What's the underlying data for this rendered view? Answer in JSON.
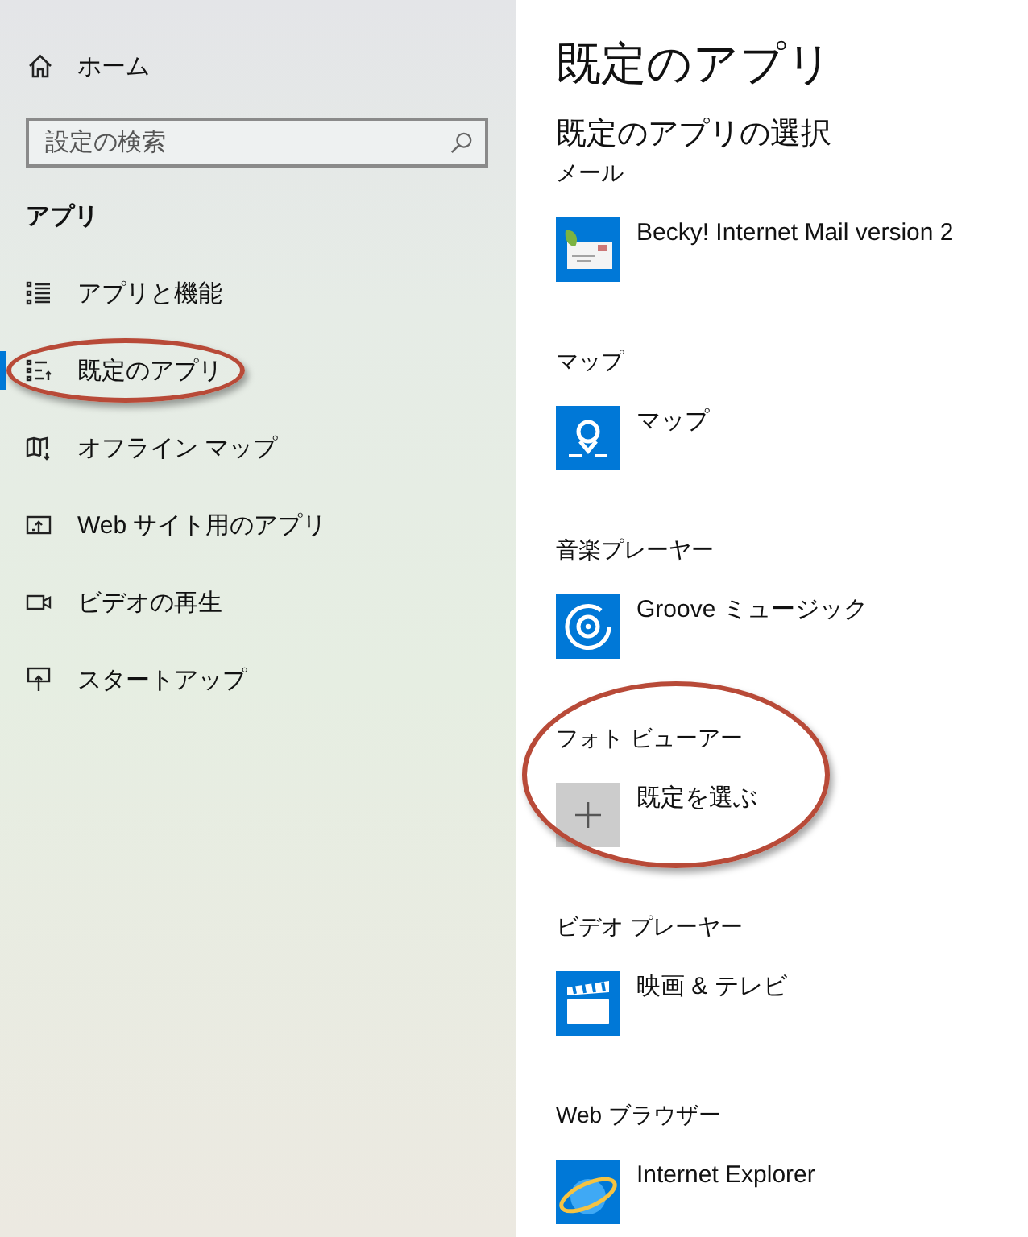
{
  "sidebar": {
    "home": {
      "label": "ホーム"
    },
    "search": {
      "placeholder": "設定の検索"
    },
    "section": "アプリ",
    "items": [
      {
        "label": "アプリと機能",
        "kind": "list",
        "selected": false,
        "circled": false
      },
      {
        "label": "既定のアプリ",
        "kind": "default",
        "selected": true,
        "circled": true
      },
      {
        "label": "オフライン マップ",
        "kind": "map",
        "selected": false,
        "circled": false
      },
      {
        "label": "Web サイト用のアプリ",
        "kind": "web",
        "selected": false,
        "circled": false
      },
      {
        "label": "ビデオの再生",
        "kind": "video",
        "selected": false,
        "circled": false
      },
      {
        "label": "スタートアップ",
        "kind": "startup",
        "selected": false,
        "circled": false
      }
    ]
  },
  "main": {
    "title": "既定のアプリ",
    "subtitle": "既定のアプリの選択",
    "categories": [
      {
        "label": "メール",
        "app": "Becky! Internet Mail version 2",
        "kind": "mail",
        "circled": false
      },
      {
        "label": "マップ",
        "app": "マップ",
        "kind": "maps",
        "circled": false
      },
      {
        "label": "音楽プレーヤー",
        "app": "Groove ミュージック",
        "kind": "music",
        "circled": false
      },
      {
        "label": "フォト ビューアー",
        "app": "既定を選ぶ",
        "kind": "choose",
        "circled": true
      },
      {
        "label": "ビデオ プレーヤー",
        "app": "映画 & テレビ",
        "kind": "film",
        "circled": false
      },
      {
        "label": "Web ブラウザー",
        "app": "Internet Explorer",
        "kind": "browser",
        "circled": false
      }
    ]
  }
}
